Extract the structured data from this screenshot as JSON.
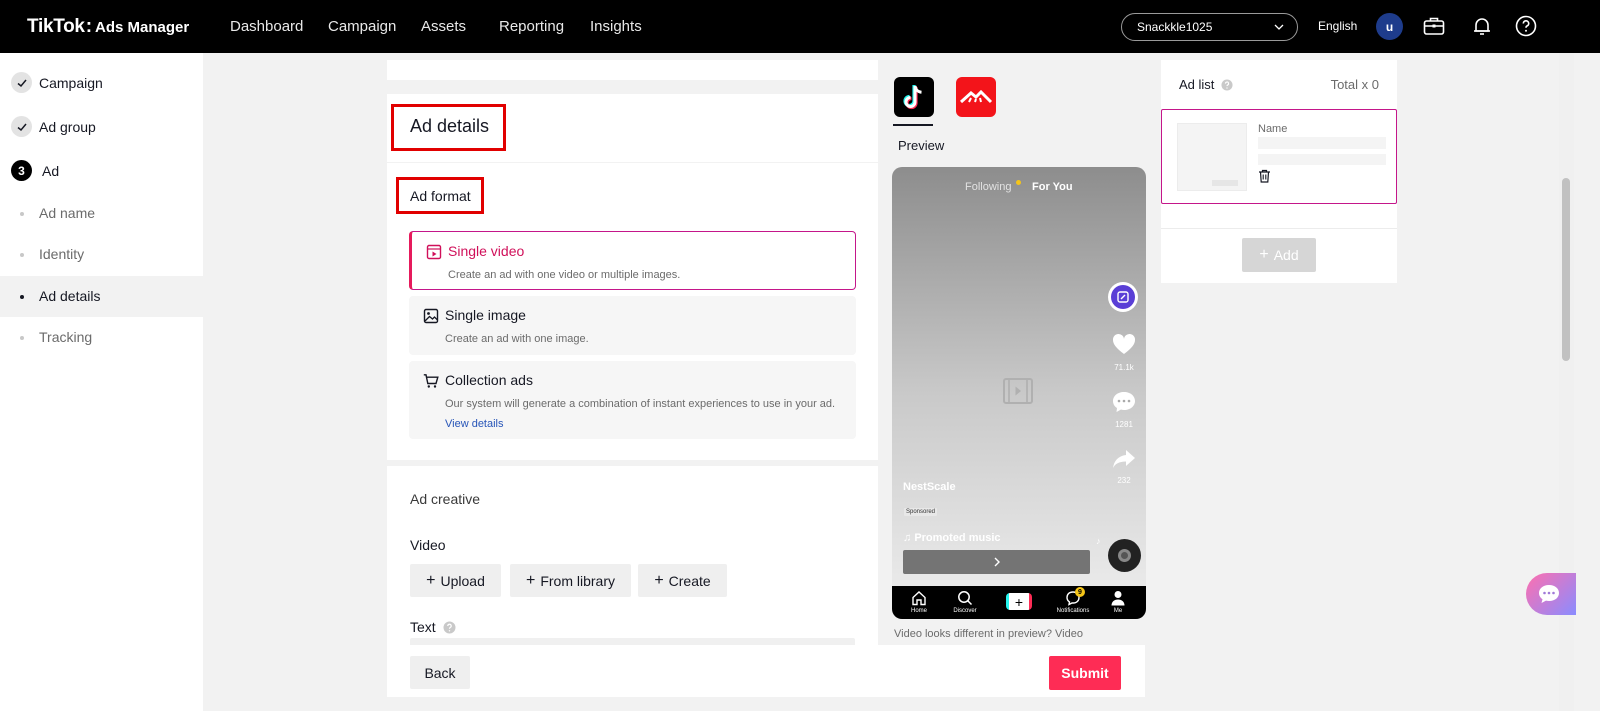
{
  "header": {
    "logo_main": "TikTok",
    "logo_sub": "Ads Manager",
    "nav": [
      "Dashboard",
      "Campaign",
      "Assets",
      "Reporting",
      "Insights"
    ],
    "account": "Snackkle1025",
    "language": "English",
    "avatar_initial": "u"
  },
  "sidebar": {
    "campaign": "Campaign",
    "ad_group": "Ad group",
    "ad_step_number": "3",
    "ad": "Ad",
    "sub_items": [
      "Ad name",
      "Identity",
      "Ad details",
      "Tracking"
    ],
    "active_sub_item": "Ad details"
  },
  "ad_details": {
    "title": "Ad details",
    "format_label": "Ad format",
    "formats": [
      {
        "title": "Single video",
        "desc": "Create an ad with one video or multiple images.",
        "selected": true
      },
      {
        "title": "Single image",
        "desc": "Create an ad with one image.",
        "selected": false
      },
      {
        "title": "Collection ads",
        "desc": "Our system will generate a combination of instant experiences to use in your ad.",
        "link": "View details",
        "selected": false
      }
    ],
    "creative_label": "Ad creative",
    "video_label": "Video",
    "video_buttons": [
      "Upload",
      "From library",
      "Create"
    ],
    "text_label": "Text"
  },
  "preview": {
    "label": "Preview",
    "feed_tabs": [
      "Following",
      "For You"
    ],
    "likes": "71.1k",
    "comments": "1281",
    "shares": "232",
    "brand": "NestScale",
    "sponsored": "Sponsored",
    "music": "Promoted music",
    "bottom_nav": [
      "Home",
      "Discover",
      "Notifications",
      "Me"
    ],
    "notif_count": "9",
    "note": "Video looks different in preview? Video"
  },
  "ad_list": {
    "title": "Ad list",
    "total": "Total x 0",
    "name_label": "Name",
    "add_button": "Add"
  },
  "footer": {
    "back": "Back",
    "submit": "Submit"
  },
  "colors": {
    "brand_pink": "#fe2c55",
    "selected_border": "#c4168a",
    "highlight_red": "#e10000"
  }
}
